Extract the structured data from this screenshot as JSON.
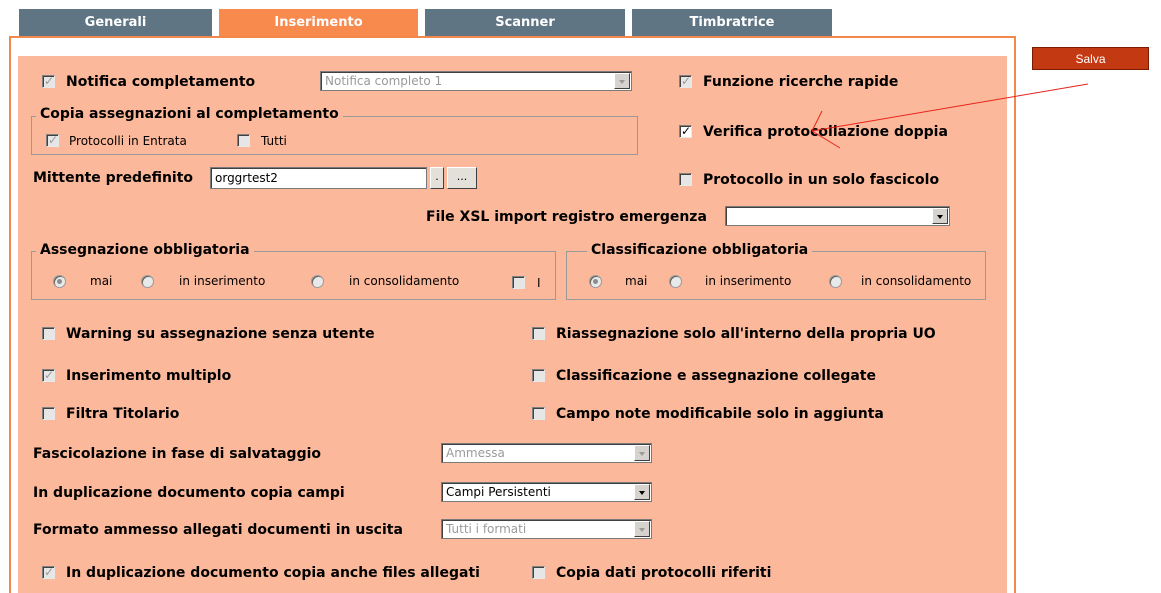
{
  "tabs": [
    {
      "label": "Generali",
      "active": false
    },
    {
      "label": "Inserimento",
      "active": true
    },
    {
      "label": "Scanner",
      "active": false
    },
    {
      "label": "Timbratrice",
      "active": false
    }
  ],
  "save_button": "Salva",
  "notifica": {
    "label": "Notifica completamento",
    "checked": true,
    "disabled": true,
    "select_value": "Notifica completo 1"
  },
  "funzione_ricerche": {
    "label": "Funzione ricerche rapide",
    "checked": true,
    "disabled": true
  },
  "copia_assegnazioni": {
    "title": "Copia assegnazioni al completamento",
    "protocolli_entrata": {
      "label": "Protocolli in Entrata",
      "checked": true,
      "disabled": true
    },
    "tutti": {
      "label": "Tutti",
      "checked": false,
      "disabled": true
    }
  },
  "verifica_protocollazione": {
    "label": "Verifica protocollazione doppia",
    "checked": true,
    "disabled": false
  },
  "mittente": {
    "label": "Mittente predefinito",
    "value": "orggrtest2",
    "btn_dot": ".",
    "btn_more": "..."
  },
  "protocollo_fascicolo": {
    "label": "Protocollo in un solo fascicolo",
    "checked": false,
    "disabled": true
  },
  "file_xsl": {
    "label": "File XSL import registro emergenza",
    "value": ""
  },
  "assegnazione": {
    "title": "Assegnazione obbligatoria",
    "options": [
      "mai",
      "in inserimento",
      "in consolidamento"
    ],
    "selected": "mai",
    "extra_checkbox_label": "I"
  },
  "classificazione": {
    "title": "Classificazione obbligatoria",
    "options": [
      "mai",
      "in inserimento",
      "in consolidamento"
    ],
    "selected": "mai"
  },
  "warning_assegnazione": {
    "label": "Warning su assegnazione senza utente",
    "checked": false
  },
  "riassegnazione": {
    "label": "Riassegnazione solo all'interno della propria UO",
    "checked": false
  },
  "inserimento_multiplo": {
    "label": "Inserimento multiplo",
    "checked": true
  },
  "classificazione_collegate": {
    "label": "Classificazione e assegnazione collegate",
    "checked": false
  },
  "filtra_titolario": {
    "label": "Filtra Titolario",
    "checked": false
  },
  "campo_note": {
    "label": "Campo note modificabile solo in aggiunta",
    "checked": false
  },
  "fascicolazione": {
    "label": "Fascicolazione in fase di salvataggio",
    "value": "Ammessa",
    "disabled": true
  },
  "duplicazione_campi": {
    "label": "In duplicazione documento copia campi",
    "value": "Campi Persistenti",
    "disabled": false
  },
  "formato_allegati": {
    "label": "Formato ammesso allegati documenti in uscita",
    "value": "Tutti i formati",
    "disabled": true
  },
  "duplicazione_files": {
    "label": "In duplicazione documento copia anche files allegati",
    "checked": true
  },
  "copia_dati": {
    "label": "Copia dati protocolli riferiti",
    "checked": false
  },
  "colors": {
    "tab_active": "#f88a4e",
    "tab_inactive": "#5f7584",
    "panel": "#fcb89a",
    "save": "#c33a12",
    "annotation": "#e8231a"
  }
}
